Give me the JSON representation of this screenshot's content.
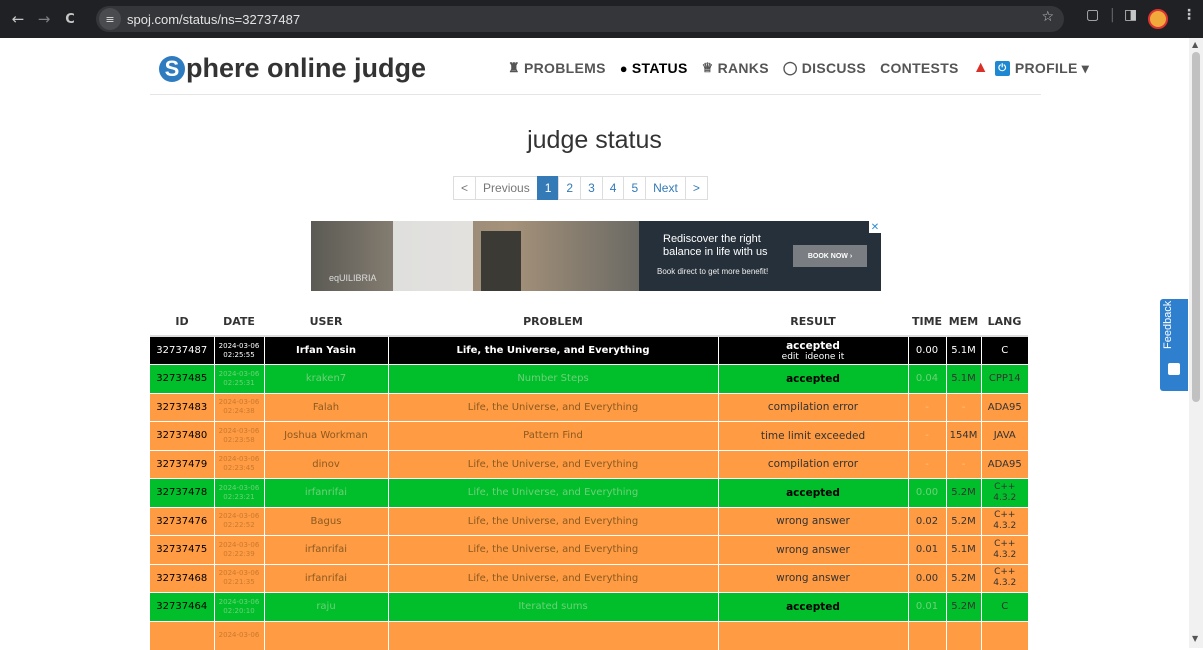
{
  "browser": {
    "url": "spoj.com/status/ns=32737487",
    "back_icon": "←",
    "forward_icon": "→",
    "reload_icon": "C",
    "site_info_icon": "≡",
    "star_icon": "☆",
    "extensions_icon": "▢",
    "sidepanel_icon": "◨",
    "menu_icon": "⋮"
  },
  "site": {
    "logo_letter": "S",
    "logo_text": "phere online judge",
    "nav": [
      {
        "label": "PROBLEMS",
        "icon": "♜"
      },
      {
        "label": "STATUS",
        "icon": "●"
      },
      {
        "label": "RANKS",
        "icon": "♕"
      },
      {
        "label": "DISCUSS",
        "icon": "◯"
      },
      {
        "label": "CONTESTS",
        "icon": ""
      },
      {
        "label": "PROFILE ▾",
        "icon": "⏻"
      }
    ],
    "warn_icon": "▲"
  },
  "page_title": "judge status",
  "pagination": {
    "prev_arrow": "<",
    "prev": "Previous",
    "pages": [
      "1",
      "2",
      "3",
      "4",
      "5"
    ],
    "current": "1",
    "next": "Next",
    "next_arrow": ">"
  },
  "ad": {
    "brand": "eqUILIBRIA",
    "headline_1": "Rediscover the right",
    "headline_2": "balance in life with us",
    "sub": "Book direct to get more benefit!",
    "button": "BOOK NOW ›",
    "close": "✕"
  },
  "feedback": {
    "label": "Feedback"
  },
  "colors": {
    "accepted": "#00bf2a",
    "error": "#ff9b43",
    "highlight": "#000000",
    "accepted_text": "#1a7a20",
    "error_text": "#7a4a10"
  },
  "table": {
    "headers": [
      "ID",
      "DATE",
      "USER",
      "PROBLEM",
      "RESULT",
      "TIME",
      "MEM",
      "LANG"
    ],
    "rows": [
      {
        "id": "32737487",
        "date1": "2024-03-06",
        "date2": "02:25:55",
        "user": "Irfan Yasin",
        "problem": "Life, the Universe, and Everything",
        "result": "accepted",
        "sub1": "edit",
        "sub2": "ideone it",
        "time": "0.00",
        "mem": "5.1M",
        "lang": "C",
        "status": "highlight"
      },
      {
        "id": "32737485",
        "date1": "2024-03-06",
        "date2": "02:25:31",
        "user": "kraken7",
        "problem": "Number Steps",
        "result": "accepted",
        "sub1": "",
        "sub2": "",
        "time": "0.04",
        "mem": "5.1M",
        "lang": "CPP14",
        "status": "accepted"
      },
      {
        "id": "32737483",
        "date1": "2024-03-06",
        "date2": "02:24:38",
        "user": "Falah",
        "problem": "Life, the Universe, and Everything",
        "result": "compilation error",
        "sub1": "",
        "sub2": "",
        "time": "-",
        "mem": "-",
        "lang": "ADA95",
        "status": "error"
      },
      {
        "id": "32737480",
        "date1": "2024-03-06",
        "date2": "02:23:58",
        "user": "Joshua Workman",
        "problem": "Pattern Find",
        "result": "time limit exceeded",
        "sub1": "",
        "sub2": "",
        "time": "-",
        "mem": "154M",
        "lang": "JAVA",
        "status": "error"
      },
      {
        "id": "32737479",
        "date1": "2024-03-06",
        "date2": "02:23:45",
        "user": "dinov",
        "problem": "Life, the Universe, and Everything",
        "result": "compilation error",
        "sub1": "",
        "sub2": "",
        "time": "-",
        "mem": "-",
        "lang": "ADA95",
        "status": "error"
      },
      {
        "id": "32737478",
        "date1": "2024-03-06",
        "date2": "02:23:21",
        "user": "irfanrifai",
        "problem": "Life, the Universe, and Everything",
        "result": "accepted",
        "sub1": "",
        "sub2": "",
        "time": "0.00",
        "mem": "5.2M",
        "lang": "C++ 4.3.2",
        "status": "accepted"
      },
      {
        "id": "32737476",
        "date1": "2024-03-06",
        "date2": "02:22:52",
        "user": "Bagus",
        "problem": "Life, the Universe, and Everything",
        "result": "wrong answer",
        "sub1": "",
        "sub2": "",
        "time": "0.02",
        "mem": "5.2M",
        "lang": "C++ 4.3.2",
        "status": "error"
      },
      {
        "id": "32737475",
        "date1": "2024-03-06",
        "date2": "02:22:39",
        "user": "irfanrifai",
        "problem": "Life, the Universe, and Everything",
        "result": "wrong answer",
        "sub1": "",
        "sub2": "",
        "time": "0.01",
        "mem": "5.1M",
        "lang": "C++ 4.3.2",
        "status": "error"
      },
      {
        "id": "32737468",
        "date1": "2024-03-06",
        "date2": "02:21:35",
        "user": "irfanrifai",
        "problem": "Life, the Universe, and Everything",
        "result": "wrong answer",
        "sub1": "",
        "sub2": "",
        "time": "0.00",
        "mem": "5.2M",
        "lang": "C++ 4.3.2",
        "status": "error"
      },
      {
        "id": "32737464",
        "date1": "2024-03-06",
        "date2": "02:20:10",
        "user": "raju",
        "problem": "Iterated sums",
        "result": "accepted",
        "sub1": "",
        "sub2": "",
        "time": "0.01",
        "mem": "5.2M",
        "lang": "C",
        "status": "accepted"
      },
      {
        "id": "",
        "date1": "2024-03-06",
        "date2": "",
        "user": "",
        "problem": "",
        "result": "",
        "sub1": "",
        "sub2": "",
        "time": "",
        "mem": "",
        "lang": "",
        "status": "error"
      }
    ]
  }
}
